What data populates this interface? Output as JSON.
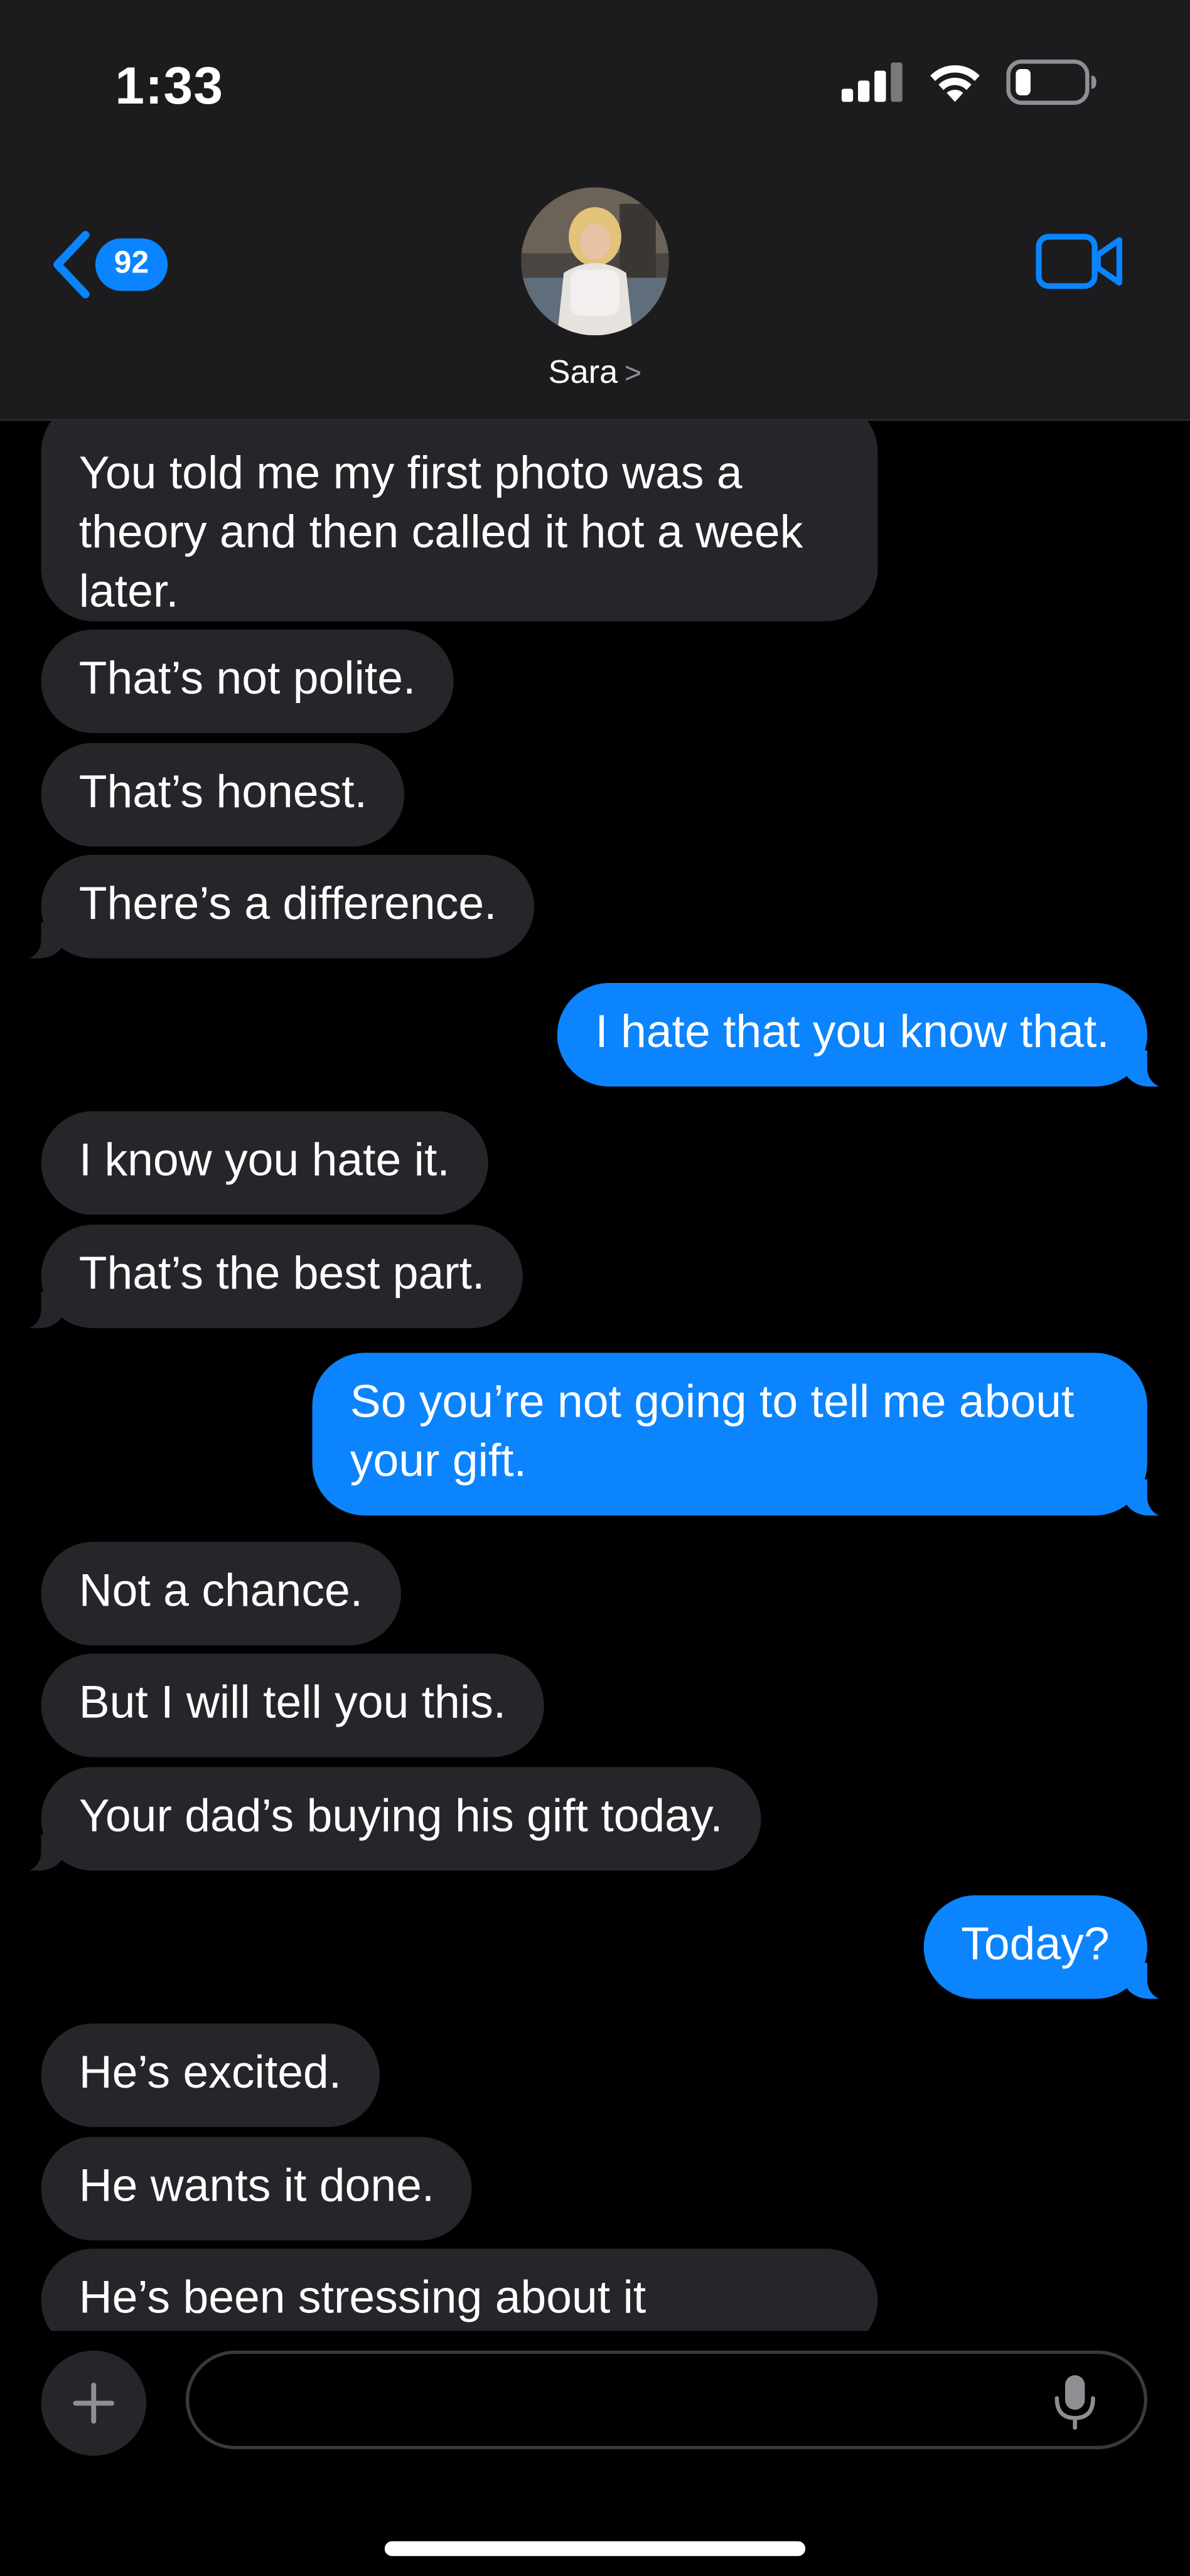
{
  "status_bar": {
    "time": "1:33",
    "icons": [
      "cellular-signal-icon",
      "wifi-icon",
      "battery-icon"
    ]
  },
  "header": {
    "back_badge": "92",
    "contact_name": "Sara",
    "contact_chevron": ">",
    "icons": [
      "chevron-left-icon",
      "video-camera-icon"
    ]
  },
  "messages": [
    {
      "side": "in",
      "text": "You told me my first photo was a theory and then called it hot a week later."
    },
    {
      "side": "in",
      "text": "That’s not polite."
    },
    {
      "side": "in",
      "text": "That’s honest."
    },
    {
      "side": "in",
      "text": "There’s a difference."
    },
    {
      "side": "out",
      "text": "I hate that you know that."
    },
    {
      "side": "in",
      "text": "I know you hate it."
    },
    {
      "side": "in",
      "text": "That’s the best part."
    },
    {
      "side": "out",
      "text": "So you’re not going to tell me about your gift."
    },
    {
      "side": "in",
      "text": "Not a chance."
    },
    {
      "side": "in",
      "text": "But I will tell you this."
    },
    {
      "side": "in",
      "text": "Your dad’s buying his gift today."
    },
    {
      "side": "out",
      "text": "Today?"
    },
    {
      "side": "in",
      "text": "He’s excited."
    },
    {
      "side": "in",
      "text": "He wants it done."
    },
    {
      "side": "in",
      "text": "He’s been stressing about it"
    }
  ],
  "composer": {
    "placeholder": "",
    "icons": [
      "plus-icon",
      "microphone-icon"
    ]
  },
  "colors": {
    "header_bg": "#1c1c1e",
    "incoming_bubble": "#26252a",
    "outgoing_bubble": "#0b84fe",
    "accent": "#0a84ff"
  }
}
